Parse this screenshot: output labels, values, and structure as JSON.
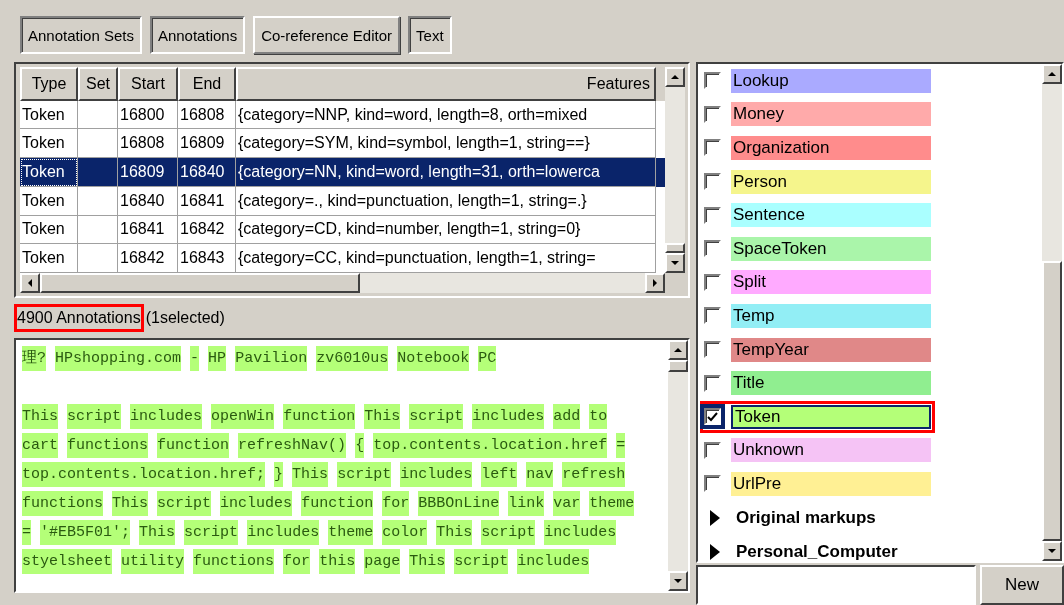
{
  "toolbar": [
    {
      "label": "Annotation Sets",
      "selected": true
    },
    {
      "label": "Annotations",
      "selected": true
    },
    {
      "label": "Co-reference Editor",
      "selected": false
    },
    {
      "label": "Text",
      "selected": true
    }
  ],
  "table": {
    "columns": [
      "Type",
      "Set",
      "Start",
      "End",
      "Features"
    ],
    "rows": [
      {
        "cells": [
          "Token",
          "",
          "16800",
          "16808",
          "{category=NNP, kind=word, length=8, orth=mixed"
        ],
        "selected": false
      },
      {
        "cells": [
          "Token",
          "",
          "16808",
          "16809",
          "{category=SYM, kind=symbol, length=1, string==}"
        ],
        "selected": false
      },
      {
        "cells": [
          "Token",
          "",
          "16809",
          "16840",
          "{category=NN, kind=word, length=31, orth=lowerca"
        ],
        "selected": true
      },
      {
        "cells": [
          "Token",
          "",
          "16840",
          "16841",
          "{category=., kind=punctuation, length=1, string=.}"
        ],
        "selected": false
      },
      {
        "cells": [
          "Token",
          "",
          "16841",
          "16842",
          "{category=CD, kind=number, length=1, string=0}"
        ],
        "selected": false
      },
      {
        "cells": [
          "Token",
          "",
          "16842",
          "16843",
          "{category=CC, kind=punctuation, length=1, string="
        ],
        "selected": false
      }
    ]
  },
  "status": {
    "count": "4900 Annotations",
    "count_highlighted": true,
    "selection": "(1selected)"
  },
  "document": {
    "paragraphs": [
      [
        "理? HPshopping.com - HP Pavilion zv6010us Notebook PC"
      ],
      [
        "This script includes openWin function This script includes add to",
        "cart functions function refreshNav() { top.contents.location.href =",
        "top.contents.location.href; } This script includes left nav refresh",
        "functions This script includes function for BBBOnLine link var theme",
        "= '#EB5F01'; This script includes theme color This script includes",
        "styelsheet utility functions for this page This script includes"
      ]
    ]
  },
  "types": [
    {
      "label": "Lookup",
      "color": "#aaaaff",
      "checked": false,
      "selected": false,
      "highlighted": false
    },
    {
      "label": "Money",
      "color": "#ffaaaa",
      "checked": false,
      "selected": false,
      "highlighted": false
    },
    {
      "label": "Organization",
      "color": "#ff8c8c",
      "checked": false,
      "selected": false,
      "highlighted": false
    },
    {
      "label": "Person",
      "color": "#f5f58c",
      "checked": false,
      "selected": false,
      "highlighted": false
    },
    {
      "label": "Sentence",
      "color": "#aaffff",
      "checked": false,
      "selected": false,
      "highlighted": false
    },
    {
      "label": "SpaceToken",
      "color": "#aaf5aa",
      "checked": false,
      "selected": false,
      "highlighted": false
    },
    {
      "label": "Split",
      "color": "#ffaaff",
      "checked": false,
      "selected": false,
      "highlighted": false
    },
    {
      "label": "Temp",
      "color": "#92eef5",
      "checked": false,
      "selected": false,
      "highlighted": false
    },
    {
      "label": "TempYear",
      "color": "#e08888",
      "checked": false,
      "selected": false,
      "highlighted": false
    },
    {
      "label": "Title",
      "color": "#90ee90",
      "checked": false,
      "selected": false,
      "highlighted": false
    },
    {
      "label": "Token",
      "color": "#b4ff78",
      "checked": true,
      "selected": true,
      "highlighted": true
    },
    {
      "label": "Unknown",
      "color": "#f5c3f5",
      "checked": false,
      "selected": false,
      "highlighted": false
    },
    {
      "label": "UrlPre",
      "color": "#fff094",
      "checked": false,
      "selected": false,
      "highlighted": false
    }
  ],
  "sets": [
    {
      "label": "Original markups",
      "expanded": false
    },
    {
      "label": "Personal_Computer",
      "expanded": false
    }
  ],
  "new_button": "New"
}
